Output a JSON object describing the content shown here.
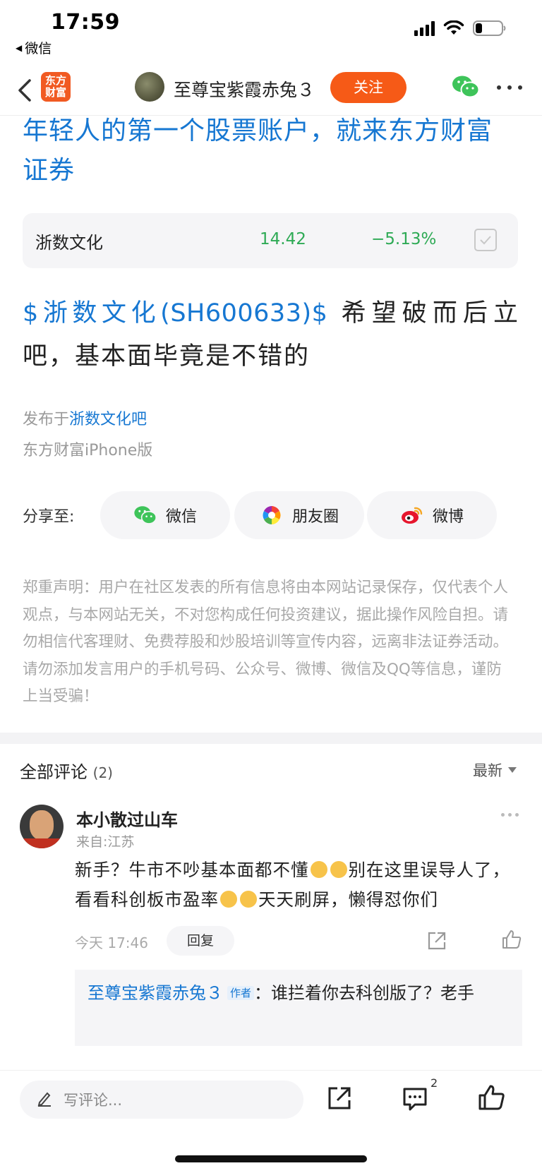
{
  "status_bar": {
    "time": "17:59",
    "back_app": "微信"
  },
  "nav": {
    "app_logo_line1": "东方",
    "app_logo_line2": "财富",
    "username": "至尊宝紫霞赤兔３",
    "follow_label": "关注"
  },
  "headline": "年轻人的第一个股票账户，就来东方财富证券",
  "stock": {
    "name": "浙数文化",
    "price": "14.42",
    "change": "−5.13%"
  },
  "post": {
    "stock_link": "$浙数文化(SH600633)$",
    "text": " 希望破而后立吧，基本面毕竟是不错的",
    "published_prefix": "发布于",
    "published_bar": "浙数文化吧",
    "platform": "东方财富iPhone版"
  },
  "share": {
    "label": "分享至:",
    "wechat": "微信",
    "moments": "朋友圈",
    "weibo": "微博"
  },
  "disclaimer": "郑重声明：用户在社区发表的所有信息将由本网站记录保存，仅代表个人观点，与本网站无关，不对您构成任何投资建议，据此操作风险自担。请勿相信代客理财、免费荐股和炒股培训等宣传内容，远离非法证券活动。请勿添加发言用户的手机号码、公众号、微博、微信及QQ等信息，谨防上当受骗！",
  "comments": {
    "title": "全部评论",
    "count": "(2)",
    "sort": "最新",
    "items": [
      {
        "name": "本小散过山车",
        "location": "来自:江苏",
        "text_1": "新手？牛市不吵基本面都不懂",
        "text_2": "别在这里误导人了，看看科创板市盈率",
        "text_3": "天天刷屏，懒得怼你们",
        "time": "今天 17:46",
        "reply_label": "回复",
        "reply": {
          "name": "至尊宝紫霞赤兔３",
          "tag": "作者",
          "text": "：谁拦着你去科创版了？老手"
        }
      }
    ]
  },
  "bottom_bar": {
    "input_placeholder": "写评论...",
    "comment_badge": "2"
  }
}
